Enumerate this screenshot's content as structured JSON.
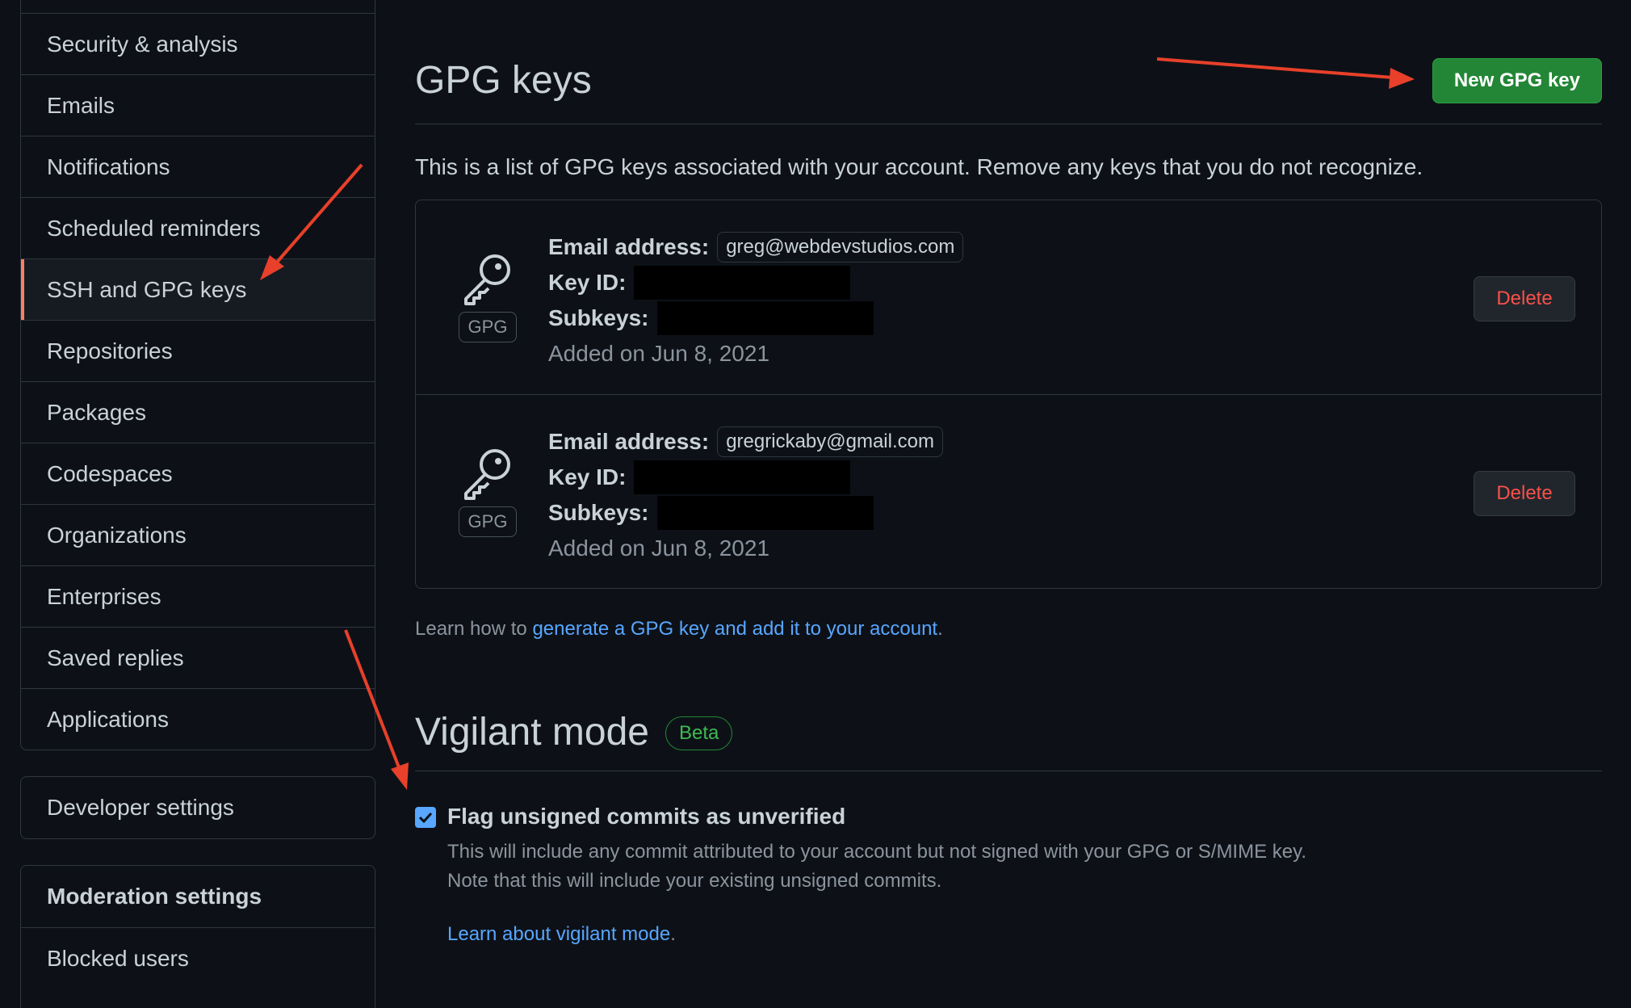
{
  "sidebar": {
    "items": [
      {
        "label": "Security & analysis"
      },
      {
        "label": "Emails"
      },
      {
        "label": "Notifications"
      },
      {
        "label": "Scheduled reminders"
      },
      {
        "label": "SSH and GPG keys"
      },
      {
        "label": "Repositories"
      },
      {
        "label": "Packages"
      },
      {
        "label": "Codespaces"
      },
      {
        "label": "Organizations"
      },
      {
        "label": "Enterprises"
      },
      {
        "label": "Saved replies"
      },
      {
        "label": "Applications"
      }
    ],
    "developer_settings": "Developer settings",
    "moderation": {
      "heading": "Moderation settings",
      "items": [
        {
          "label": "Blocked users"
        }
      ]
    }
  },
  "gpg": {
    "title": "GPG keys",
    "new_button": "New GPG key",
    "intro": "This is a list of GPG keys associated with your account. Remove any keys that you do not recognize.",
    "keys": [
      {
        "badge": "GPG",
        "email_label": "Email address:",
        "email": "greg@webdevstudios.com",
        "key_id_label": "Key ID:",
        "subkeys_label": "Subkeys:",
        "added": "Added on Jun 8, 2021",
        "delete_label": "Delete"
      },
      {
        "badge": "GPG",
        "email_label": "Email address:",
        "email": "gregrickaby@gmail.com",
        "key_id_label": "Key ID:",
        "subkeys_label": "Subkeys:",
        "added": "Added on Jun 8, 2021",
        "delete_label": "Delete"
      }
    ],
    "learn_prefix": "Learn how to ",
    "learn_link": "generate a GPG key and add it to your account",
    "learn_suffix": "."
  },
  "vigilant": {
    "title": "Vigilant mode",
    "badge": "Beta",
    "checkbox_label": "Flag unsigned commits as unverified",
    "checked": true,
    "note_line1": "This will include any commit attributed to your account but not signed with your GPG or S/MIME key.",
    "note_line2": "Note that this will include your existing unsigned commits.",
    "learn_link": "Learn about vigilant mode",
    "learn_suffix": "."
  },
  "colors": {
    "background": "#0d1117",
    "border": "#30363d",
    "primary_button": "#238636",
    "link": "#58a6ff",
    "danger": "#f85149",
    "selected_marker": "#f78166",
    "annotation_arrow": "#e8402a"
  },
  "icons": {
    "key": "key-icon",
    "checkbox": "check-icon"
  }
}
